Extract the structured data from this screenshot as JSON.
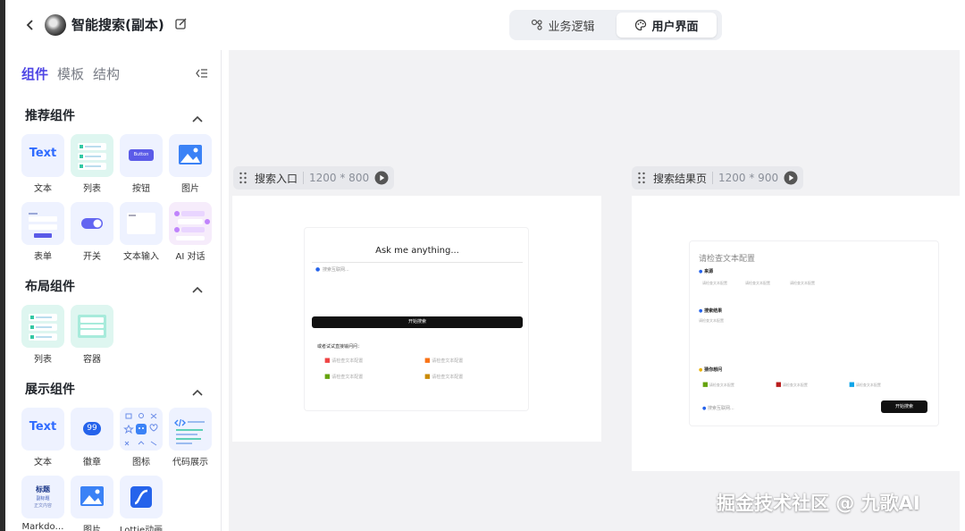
{
  "header": {
    "app_title": "智能搜索(副本)",
    "mode_tabs": [
      {
        "label": "业务逻辑",
        "icon": "flow-icon"
      },
      {
        "label": "用户界面",
        "icon": "palette-icon"
      }
    ],
    "active_mode": "用户界面"
  },
  "left_panel": {
    "tabs": [
      "组件",
      "模板",
      "结构"
    ],
    "active_tab": "组件",
    "sections": [
      {
        "title": "推荐组件",
        "items": [
          "文本",
          "列表",
          "按钮",
          "图片",
          "表单",
          "开关",
          "文本输入",
          "AI 对话"
        ]
      },
      {
        "title": "布局组件",
        "items": [
          "列表",
          "容器"
        ]
      },
      {
        "title": "展示组件",
        "items": [
          "文本",
          "徽章",
          "图标",
          "代码展示",
          "Markdo…",
          "图片",
          "Lottie动画"
        ]
      }
    ],
    "tile_text": {
      "text_tile": "Text",
      "button_tile": "Button",
      "badge_tile": "99",
      "md_title": "标题",
      "md_sub1": "副标题",
      "md_sub2": "正文内容"
    }
  },
  "canvas": {
    "pages": [
      {
        "name": "搜索入口",
        "size": "1200 * 800",
        "heading": "Ask me anything...",
        "input_placeholder": "搜索互联网...",
        "button_label": "开始搜索",
        "suggest_title": "或者试试直接输问问：",
        "suggestions": [
          "请检查文本配置",
          "请检查文本配置",
          "请检查文本配置",
          "请检查文本配置"
        ]
      },
      {
        "name": "搜索结果页",
        "size": "1200 * 900",
        "page_title": "请检查文本配置",
        "source_label": "来源",
        "sources": [
          "请检查文本配置",
          "请检查文本配置",
          "请检查文本配置"
        ],
        "result_label": "搜索结果",
        "result_text": "请检查文本配置",
        "related_label": "猜你想问",
        "related": [
          "请检查文本配置",
          "请检查文本配置",
          "请检查文本配置"
        ],
        "input_placeholder": "搜索互联网...",
        "button_label": "开始搜索"
      }
    ]
  },
  "watermark": "掘金技术社区 @ 九歌AI",
  "colors": {
    "accent": "#4f46e5",
    "tile_blue": "#eef2ff",
    "tile_green": "#e6f7f4",
    "canvas_bg": "#f2f2f4"
  }
}
